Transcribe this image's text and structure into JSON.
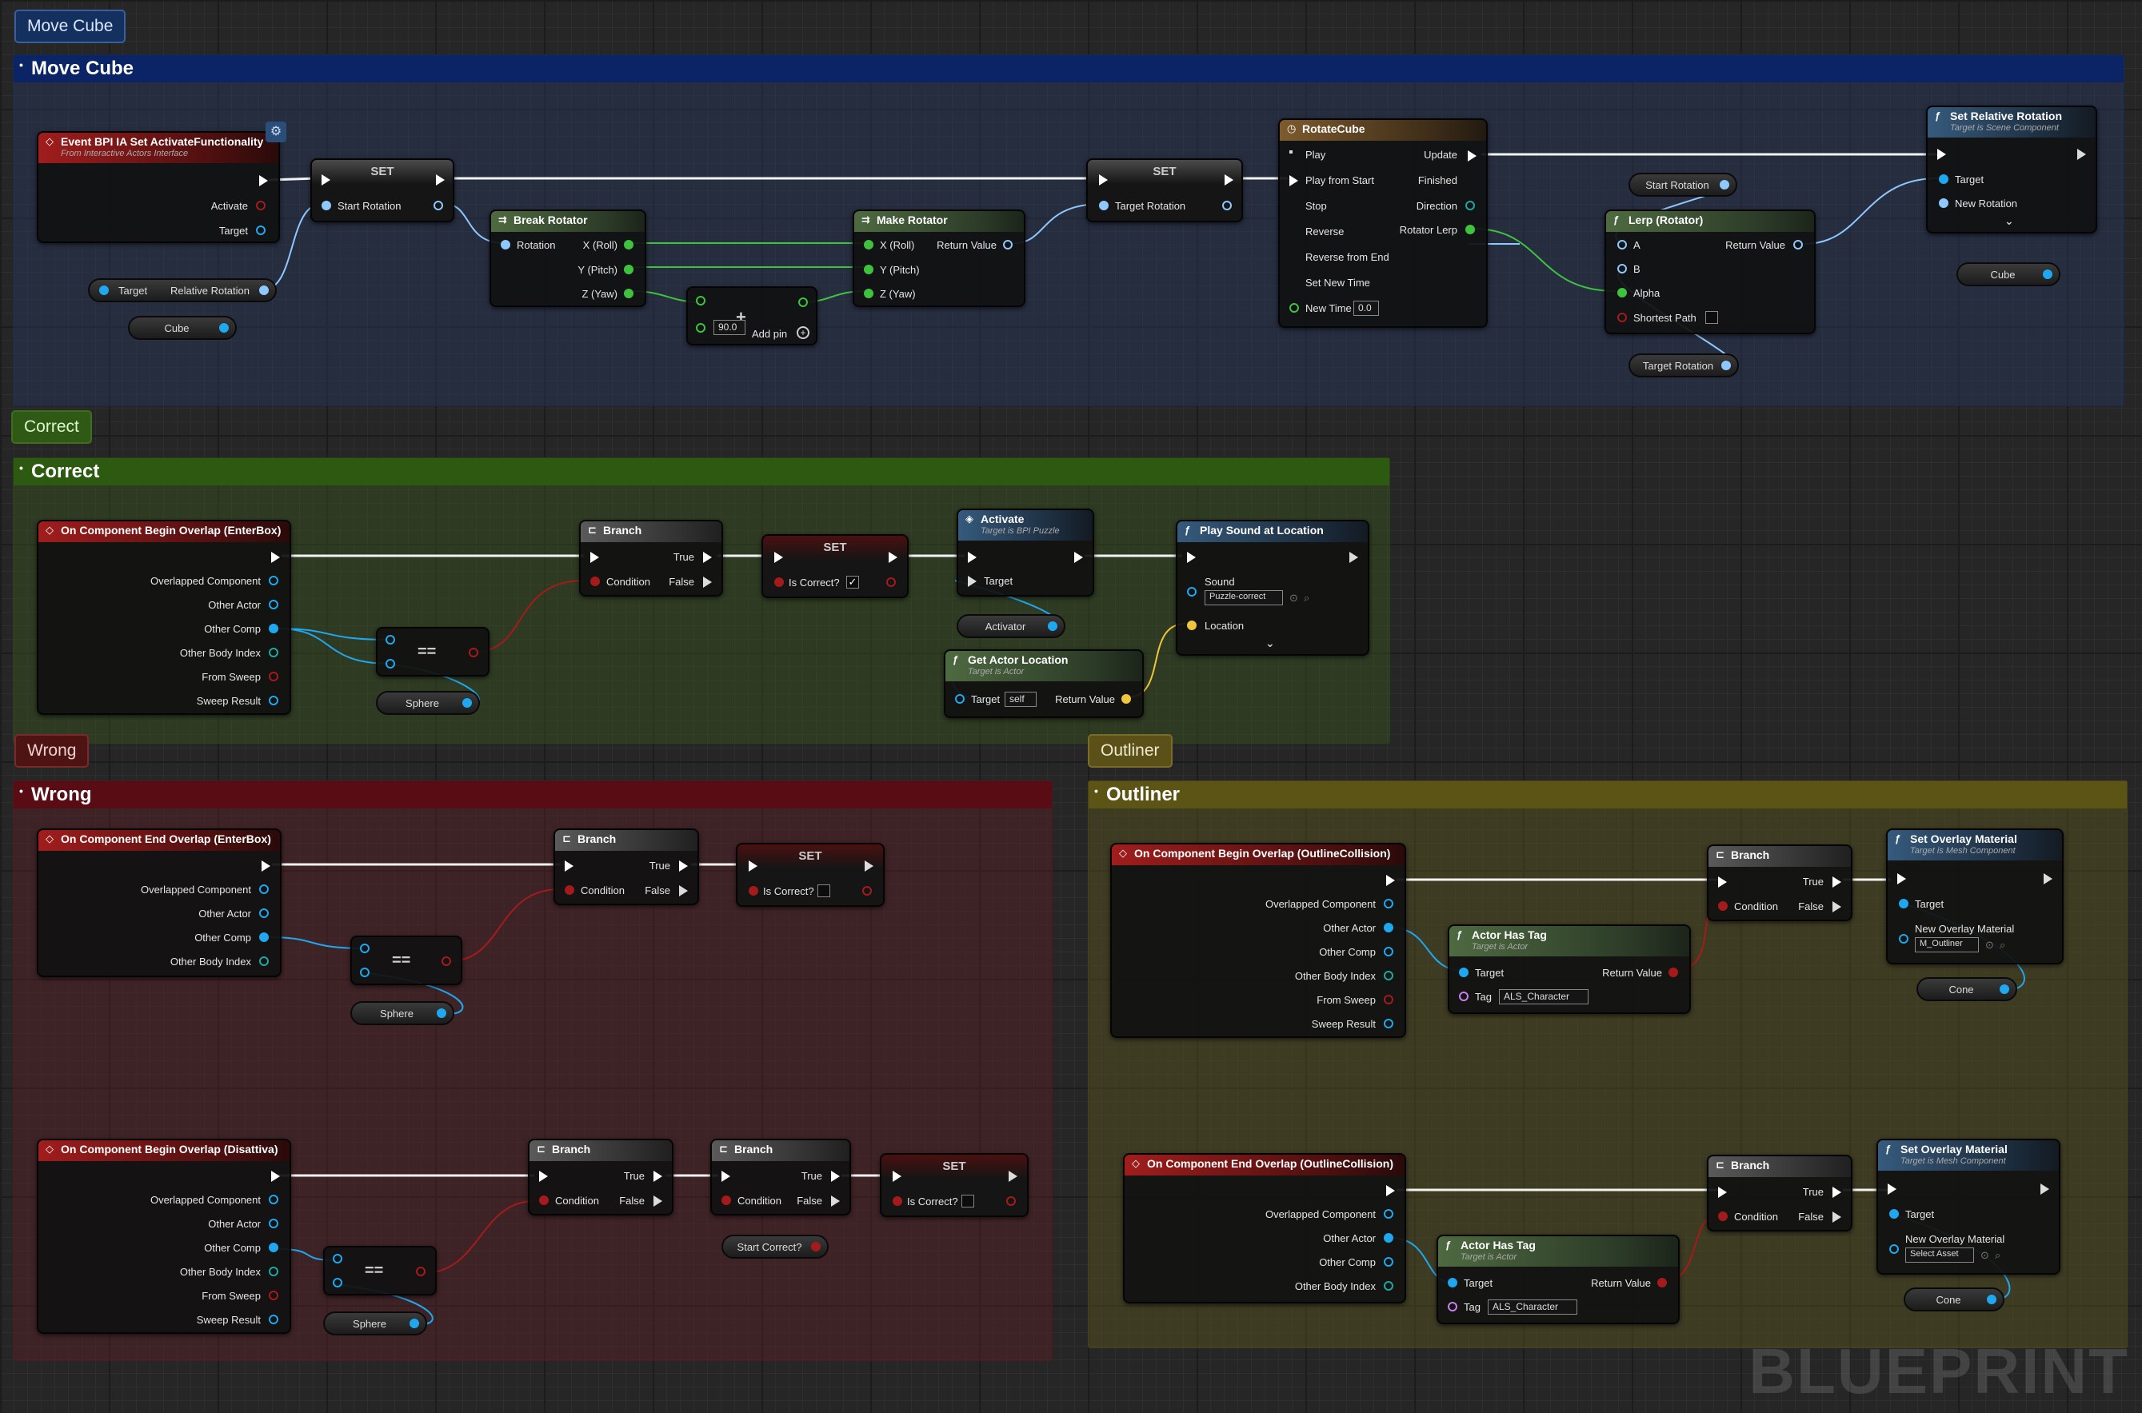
{
  "comments": {
    "move_cube": {
      "tab": "Move Cube",
      "title": "Move Cube"
    },
    "correct": {
      "tab": "Correct",
      "title": "Correct"
    },
    "wrong": {
      "tab": "Wrong",
      "title": "Wrong"
    },
    "outliner": {
      "tab": "Outliner",
      "title": "Outliner"
    }
  },
  "move": {
    "event": {
      "title": "Event BPI IA Set ActivateFunctionality",
      "subtitle": "From Interactive Actors Interface",
      "activate": "Activate",
      "target": "Target"
    },
    "get_target": {
      "target": "Target",
      "relative_rotation": "Relative Rotation"
    },
    "cube1": "Cube",
    "set1": {
      "title": "SET",
      "pin": "Start Rotation"
    },
    "break": {
      "title": "Break Rotator",
      "rotation": "Rotation",
      "x": "X (Roll)",
      "y": "Y (Pitch)",
      "z": "Z (Yaw)"
    },
    "add": {
      "value": "90.0",
      "add_pin": "Add pin"
    },
    "make": {
      "title": "Make Rotator",
      "x": "X (Roll)",
      "y": "Y (Pitch)",
      "z": "Z (Yaw)",
      "ret": "Return Value"
    },
    "set2": {
      "title": "SET",
      "pin": "Target Rotation"
    },
    "timeline": {
      "title": "RotateCube",
      "play": "Play",
      "play_start": "Play from Start",
      "stop": "Stop",
      "reverse": "Reverse",
      "reverse_end": "Reverse from End",
      "set_new_time": "Set New Time",
      "new_time": "New Time",
      "new_time_val": "0.0",
      "update": "Update",
      "finished": "Finished",
      "direction": "Direction",
      "lerp": "Rotator Lerp"
    },
    "start_rot": "Start Rotation",
    "target_rot": "Target Rotation",
    "lerp": {
      "title": "Lerp (Rotator)",
      "a": "A",
      "b": "B",
      "alpha": "Alpha",
      "shortest": "Shortest Path",
      "ret": "Return Value"
    },
    "set_rel": {
      "title": "Set Relative Rotation",
      "subtitle": "Target is Scene Component",
      "target": "Target",
      "new_rot": "New Rotation"
    },
    "cube2": "Cube"
  },
  "correct": {
    "event": {
      "title": "On Component Begin Overlap (EnterBox)",
      "p1": "Overlapped Component",
      "p2": "Other Actor",
      "p3": "Other Comp",
      "p4": "Other Body Index",
      "p5": "From Sweep",
      "p6": "Sweep Result"
    },
    "eq": "==",
    "sphere": "Sphere",
    "branch": {
      "title": "Branch",
      "cond": "Condition",
      "t": "True",
      "f": "False"
    },
    "set": {
      "title": "SET",
      "pin": "Is Correct?",
      "check": "✓"
    },
    "activate": {
      "title": "Activate",
      "subtitle": "Target is BPI Puzzle",
      "target": "Target"
    },
    "activator": "Activator",
    "get_loc": {
      "title": "Get Actor Location",
      "subtitle": "Target is Actor",
      "target": "Target",
      "self": "self",
      "ret": "Return Value"
    },
    "play_sound": {
      "title": "Play Sound at Location",
      "sound": "Sound",
      "sound_val": "Puzzle-correct",
      "location": "Location"
    }
  },
  "wrong": {
    "event1": {
      "title": "On Component End Overlap (EnterBox)",
      "p1": "Overlapped Component",
      "p2": "Other Actor",
      "p3": "Other Comp",
      "p4": "Other Body Index"
    },
    "eq1": "==",
    "sphere1": "Sphere",
    "branch1": {
      "title": "Branch",
      "cond": "Condition",
      "t": "True",
      "f": "False"
    },
    "set1": {
      "title": "SET",
      "pin": "Is Correct?"
    },
    "event2": {
      "title": "On Component Begin Overlap (Disattiva)",
      "p1": "Overlapped Component",
      "p2": "Other Actor",
      "p3": "Other Comp",
      "p4": "Other Body Index",
      "p5": "From Sweep",
      "p6": "Sweep Result"
    },
    "eq2": "==",
    "sphere2": "Sphere",
    "branch2": {
      "title": "Branch",
      "cond": "Condition",
      "t": "True",
      "f": "False"
    },
    "branch3": {
      "title": "Branch",
      "cond": "Condition",
      "t": "True",
      "f": "False"
    },
    "start_correct": "Start Correct?",
    "set2": {
      "title": "SET",
      "pin": "Is Correct?"
    }
  },
  "outliner": {
    "event1": {
      "title": "On Component Begin Overlap (OutlineCollision)",
      "p1": "Overlapped Component",
      "p2": "Other Actor",
      "p3": "Other Comp",
      "p4": "Other Body Index",
      "p5": "From Sweep",
      "p6": "Sweep Result"
    },
    "has_tag1": {
      "title": "Actor Has Tag",
      "subtitle": "Target is Actor",
      "target": "Target",
      "tag": "Tag",
      "tag_val": "ALS_Character",
      "ret": "Return Value"
    },
    "branch1": {
      "title": "Branch",
      "cond": "Condition",
      "t": "True",
      "f": "False"
    },
    "set_mat1": {
      "title": "Set Overlay Material",
      "subtitle": "Target is Mesh Component",
      "target": "Target",
      "new_mat": "New Overlay Material",
      "mat_val": "M_Outliner"
    },
    "cone1": "Cone",
    "event2": {
      "title": "On Component End Overlap (OutlineCollision)",
      "p1": "Overlapped Component",
      "p2": "Other Actor",
      "p3": "Other Comp",
      "p4": "Other Body Index"
    },
    "has_tag2": {
      "title": "Actor Has Tag",
      "subtitle": "Target is Actor",
      "target": "Target",
      "tag": "Tag",
      "tag_val": "ALS_Character",
      "ret": "Return Value"
    },
    "branch2": {
      "title": "Branch",
      "cond": "Condition",
      "t": "True",
      "f": "False"
    },
    "set_mat2": {
      "title": "Set Overlay Material",
      "subtitle": "Target is Mesh Component",
      "target": "Target",
      "new_mat": "New Overlay Material",
      "mat_val": "Select Asset"
    },
    "cone2": "Cone"
  },
  "watermark": "BLUEPRINT",
  "colors": {
    "exec": "#ffffff",
    "object": "#1fa8f0",
    "bool": "#a51b1b",
    "rotator": "#8fc7ff",
    "float": "#3fc33f",
    "vector": "#f0c63c",
    "name": "#c880f0",
    "struct": "#1fa8a0"
  }
}
